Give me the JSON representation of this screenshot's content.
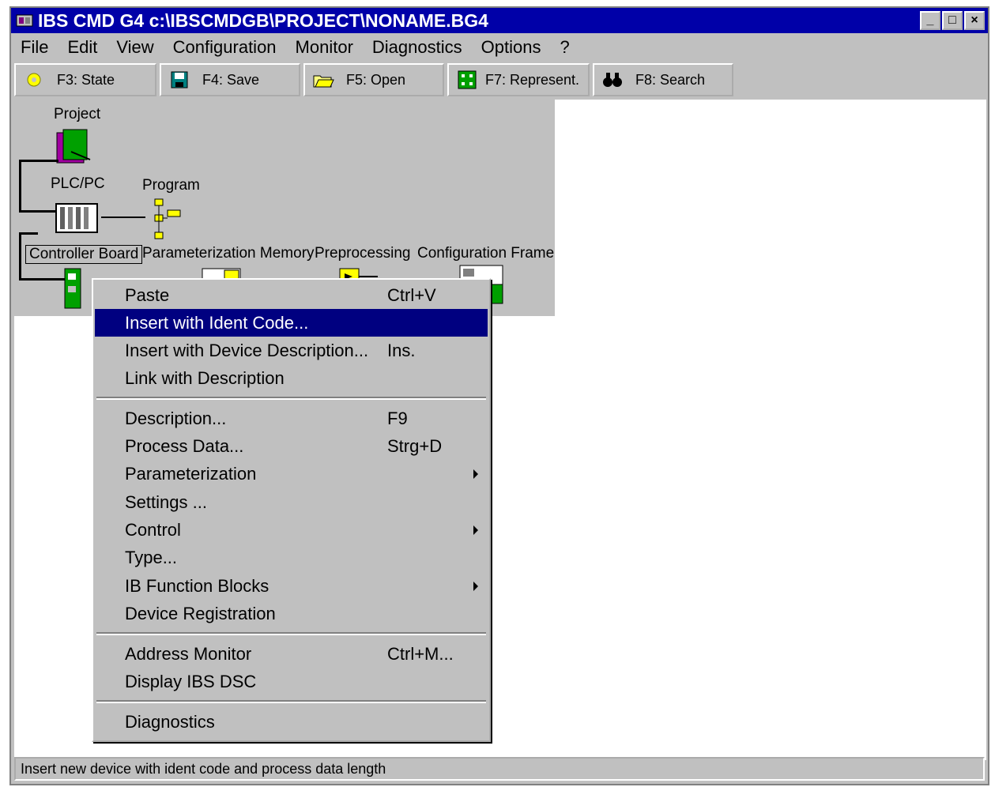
{
  "window": {
    "title": "IBS CMD G4 c:\\IBSCMDGB\\PROJECT\\NONAME.BG4"
  },
  "window_controls": {
    "minimize": "_",
    "maximize": "□",
    "close": "×"
  },
  "menubar": [
    "File",
    "Edit",
    "View",
    "Configuration",
    "Monitor",
    "Diagnostics",
    "Options",
    "?"
  ],
  "toolbar": [
    {
      "label": "F3: State",
      "icon": "state-icon"
    },
    {
      "label": "F4: Save",
      "icon": "save-icon"
    },
    {
      "label": "F5: Open",
      "icon": "open-icon"
    },
    {
      "label": "F7: Represent.",
      "icon": "represent-icon"
    },
    {
      "label": "F8: Search",
      "icon": "search-icon"
    }
  ],
  "tree": {
    "project": "Project",
    "plc": "PLC/PC",
    "program": "Program",
    "controller_board": "Controller Board",
    "param_memory": "Parameterization Memory",
    "preprocessing": "Preprocessing",
    "config_frame": "Configuration Frame"
  },
  "context_menu": {
    "groups": [
      [
        {
          "label": "Paste",
          "shortcut": "Ctrl+V",
          "submenu": false,
          "selected": false
        },
        {
          "label": "Insert with Ident Code...",
          "shortcut": "",
          "submenu": false,
          "selected": true
        },
        {
          "label": "Insert with Device Description...",
          "shortcut": "Ins.",
          "submenu": false,
          "selected": false
        },
        {
          "label": "Link with Description",
          "shortcut": "",
          "submenu": false,
          "selected": false
        }
      ],
      [
        {
          "label": "Description...",
          "shortcut": "F9",
          "submenu": false,
          "selected": false
        },
        {
          "label": "Process Data...",
          "shortcut": "Strg+D",
          "submenu": false,
          "selected": false
        },
        {
          "label": "Parameterization",
          "shortcut": "",
          "submenu": true,
          "selected": false
        },
        {
          "label": "Settings ...",
          "shortcut": "",
          "submenu": false,
          "selected": false
        },
        {
          "label": "Control",
          "shortcut": "",
          "submenu": true,
          "selected": false
        },
        {
          "label": "Type...",
          "shortcut": "",
          "submenu": false,
          "selected": false
        },
        {
          "label": "IB Function Blocks",
          "shortcut": "",
          "submenu": true,
          "selected": false
        },
        {
          "label": "Device Registration",
          "shortcut": "",
          "submenu": false,
          "selected": false
        }
      ],
      [
        {
          "label": "Address Monitor",
          "shortcut": "Ctrl+M...",
          "submenu": false,
          "selected": false
        },
        {
          "label": "Display IBS DSC",
          "shortcut": "",
          "submenu": false,
          "selected": false
        }
      ],
      [
        {
          "label": "Diagnostics",
          "shortcut": "",
          "submenu": false,
          "selected": false
        }
      ]
    ]
  },
  "statusbar": {
    "text": "Insert new device with ident code and process data length"
  },
  "colors": {
    "titlebar": "#0000a8",
    "selection": "#000080",
    "face": "#c0c0c0"
  }
}
